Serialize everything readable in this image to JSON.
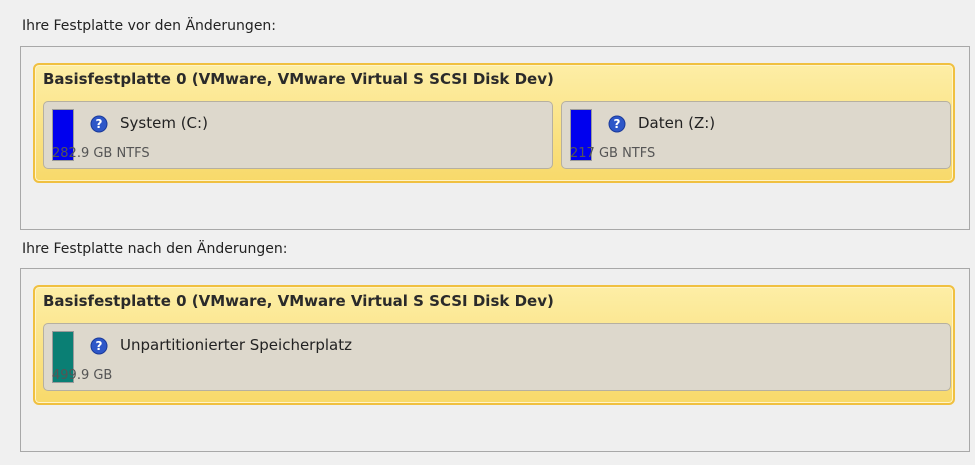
{
  "before": {
    "label": "Ihre Festplatte vor den Änderungen:",
    "disk_title": "Basisfestplatte 0 (VMware, VMware Virtual S SCSI Disk Dev)",
    "partitions": [
      {
        "name": "System (C:)",
        "size": "282.9 GB NTFS",
        "color": "#0000ee",
        "icon": "help-icon"
      },
      {
        "name": "Daten (Z:)",
        "size": "217 GB NTFS",
        "color": "#0000ee",
        "icon": "help-icon"
      }
    ]
  },
  "after": {
    "label": "Ihre Festplatte nach den Änderungen:",
    "disk_title": "Basisfestplatte 0 (VMware, VMware Virtual S SCSI Disk Dev)",
    "partitions": [
      {
        "name": "Unpartitionierter Speicherplatz",
        "size": "499.9 GB",
        "color": "#0a7f74",
        "icon": "help-icon"
      }
    ]
  },
  "colors": {
    "disk_border": "#f0c040",
    "disk_fill": "#f8d96a",
    "partition_fill": "#ddd8cc",
    "help_icon": "#2e57c8"
  }
}
